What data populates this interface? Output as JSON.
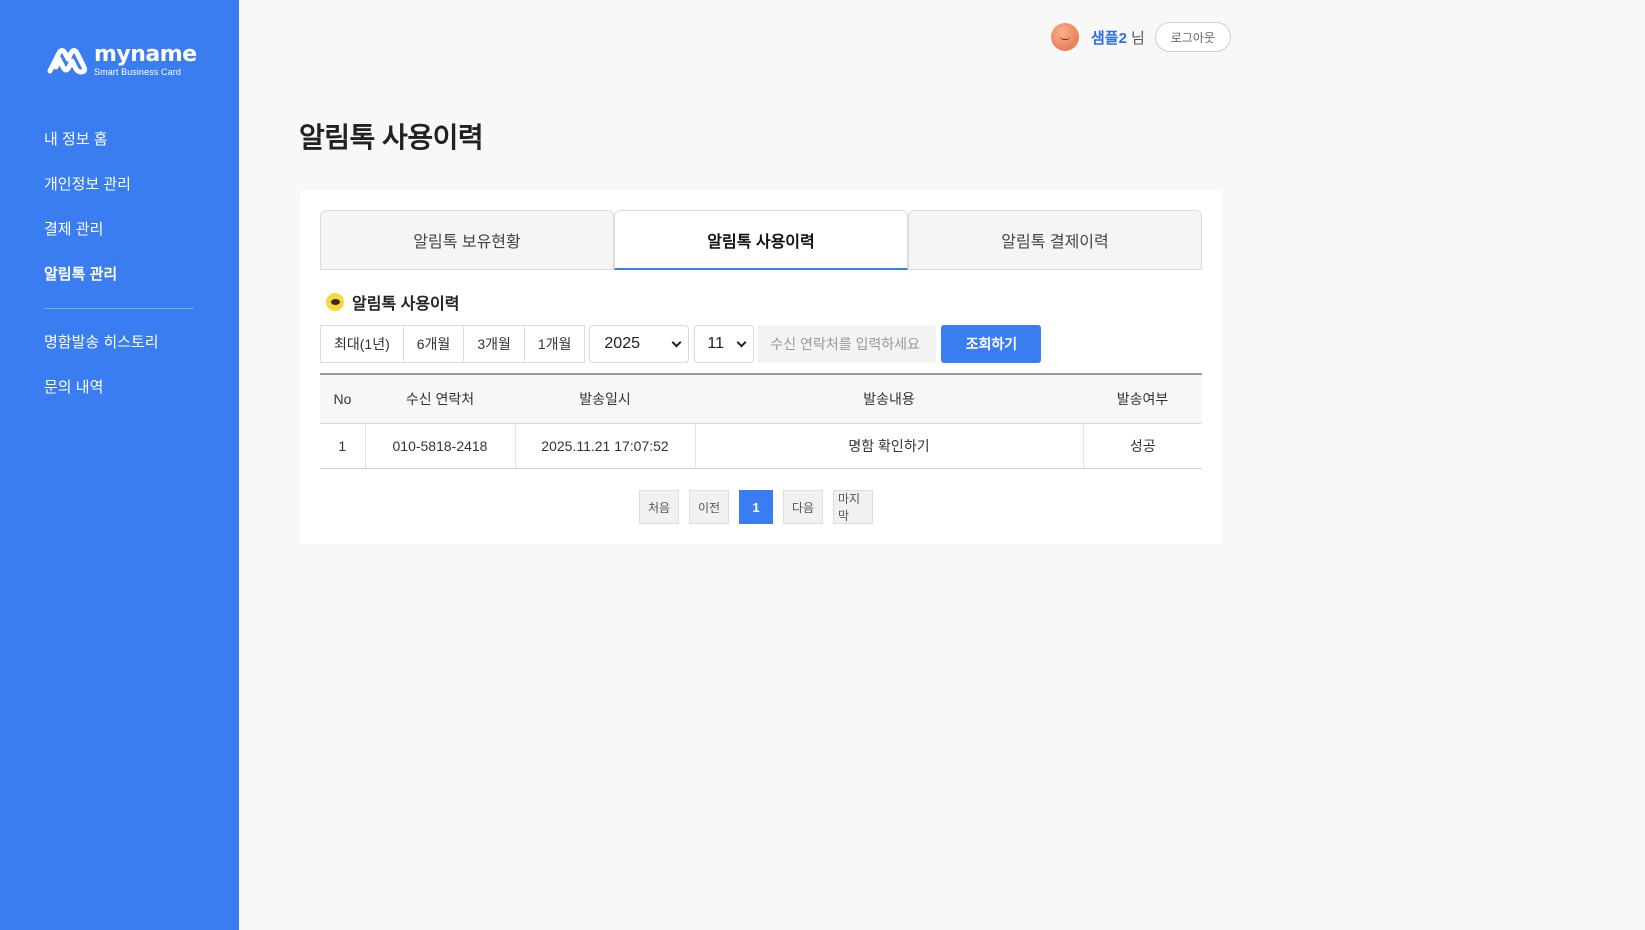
{
  "sidebar": {
    "logo": {
      "name": "myname",
      "tagline": "Smart Business Card"
    },
    "items": [
      {
        "label": "내 정보 홈"
      },
      {
        "label": "개인정보 관리"
      },
      {
        "label": "결제 관리"
      },
      {
        "label": "알림톡 관리",
        "active": true
      },
      {
        "label": "명함발송 히스토리"
      },
      {
        "label": "문의 내역"
      }
    ]
  },
  "header": {
    "user_name": "샘플2",
    "user_suffix": "님",
    "logout_label": "로그아웃"
  },
  "main": {
    "page_title": "알림톡 사용이력",
    "tabs": [
      {
        "label": "알림톡 보유현황"
      },
      {
        "label": "알림톡 사용이력",
        "active": true
      },
      {
        "label": "알림톡 결제이력"
      }
    ],
    "section_title": "알림톡 사용이력",
    "filters": {
      "periods": [
        "최대(1년)",
        "6개월",
        "3개월",
        "1개월"
      ],
      "year": "2025",
      "month": "11",
      "search_placeholder": "수신 연락처를 입력하세요",
      "search_button": "조회하기"
    },
    "table": {
      "columns": [
        "No",
        "수신 연락처",
        "발송일시",
        "발송내용",
        "발송여부"
      ],
      "rows": [
        [
          "1",
          "010-5818-2418",
          "2025.11.21 17:07:52",
          "명함 확인하기",
          "성공"
        ]
      ]
    },
    "pagination": {
      "first": "처음",
      "prev": "이전",
      "current": "1",
      "next": "다음",
      "last": "마지막"
    }
  },
  "colors": {
    "primary": "#3a7df0",
    "sidebar_bg": "#3a7df0",
    "page_bg": "#f8f8f8",
    "kakao_yellow": "#f7d93c"
  }
}
